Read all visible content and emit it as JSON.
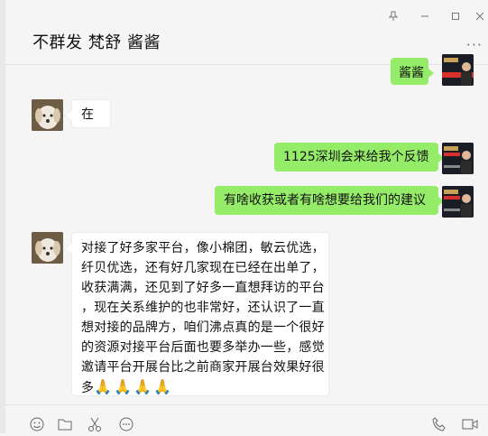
{
  "header": {
    "title": "不群发 梵舒  酱酱",
    "pin_icon": "pin-icon",
    "min_icon": "minimize-icon",
    "max_icon": "maximize-icon",
    "close_icon": "close-icon",
    "more_icon": "more-icon"
  },
  "messages": [
    {
      "side": "right",
      "text": "酱酱"
    },
    {
      "side": "left",
      "text": "在"
    },
    {
      "side": "right",
      "text": "1125深圳会来给我个反馈"
    },
    {
      "side": "right",
      "text": "有啥收获或者有啥想要给我们的建议"
    },
    {
      "side": "left",
      "text": "对接了好多家平台，像小棉团，敏云优选，\n纤贝优选，还有好几家现在已经在出单了，\n收获满满，还见到了好多一直想拜访的平台\n，现在关系维护的也非常好，还认识了一直\n想对接的品牌方，咱们沸点真的是一个很好\n的资源对接平台后面也要多举办一些，感觉\n邀请平台开展台比之前商家开展台效果好很\n多",
      "emojis": [
        "🙏",
        "🙏",
        "🙏",
        "🙏"
      ]
    }
  ],
  "composer": {
    "icons": [
      "emoji-icon",
      "folder-icon",
      "scissors-icon",
      "chat-bubble-icon",
      "phone-icon",
      "video-icon"
    ]
  },
  "colors": {
    "bubble_right": "#95ec69",
    "bubble_left": "#ffffff",
    "bg": "#f5f5f5"
  }
}
